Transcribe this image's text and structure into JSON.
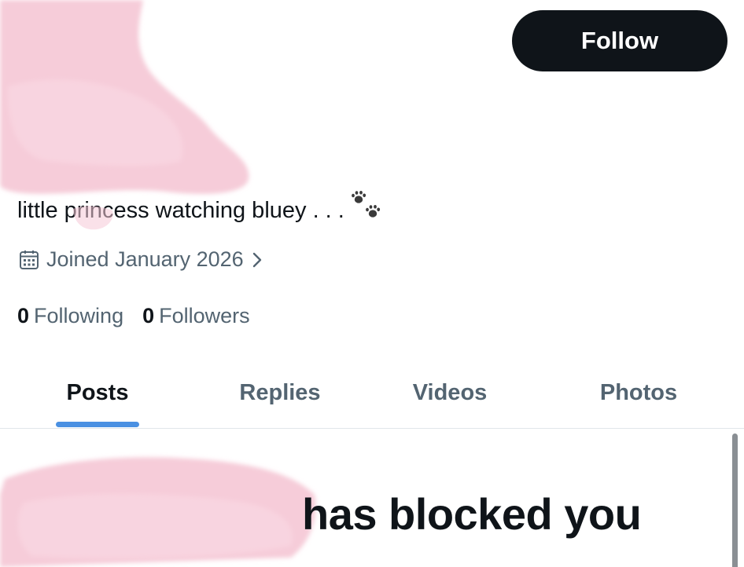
{
  "header": {
    "follow_label": "Follow"
  },
  "profile": {
    "bio": "little princess watching bluey . . .",
    "bio_emoji": "paw-prints-icon",
    "joined": "Joined January 2026",
    "following_count": "0",
    "following_label": "Following",
    "followers_count": "0",
    "followers_label": "Followers"
  },
  "tabs": [
    {
      "label": "Posts",
      "active": true
    },
    {
      "label": "Replies",
      "active": false
    },
    {
      "label": "Videos",
      "active": false
    },
    {
      "label": "Photos",
      "active": false
    }
  ],
  "main": {
    "blocked_message": "has blocked you"
  },
  "colors": {
    "text_primary": "#0f1419",
    "text_secondary": "#536471",
    "tab_indicator": "#4a90e2",
    "redaction_pink": "#f6c7d6"
  }
}
